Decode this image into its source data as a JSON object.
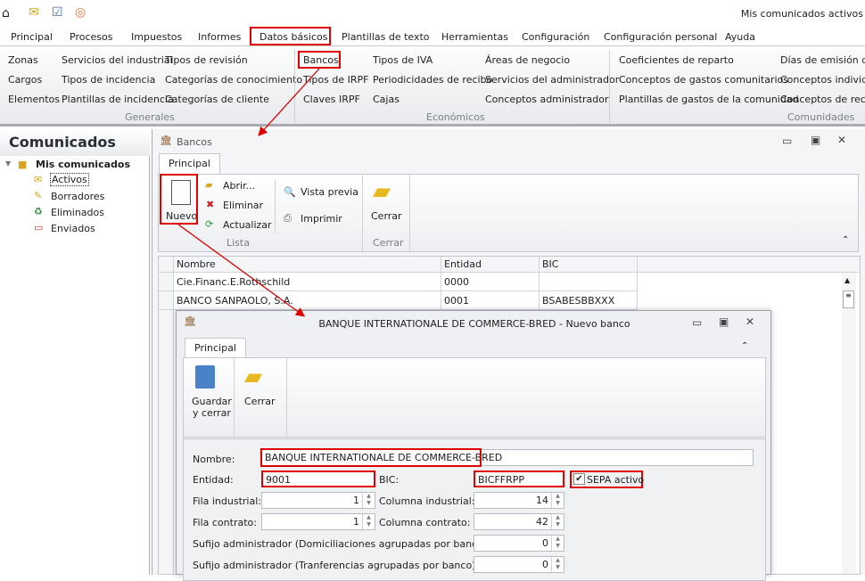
{
  "app": {
    "title": "Mis comunicados activos"
  },
  "colors": {
    "highlight": "#e00000",
    "accent": "#1e1e1e"
  },
  "menu": [
    "Principal",
    "Procesos",
    "Impuestos",
    "Informes",
    "Datos básicos",
    "Plantillas de texto",
    "Herramientas",
    "Configuración",
    "Configuración personal",
    "Ayuda"
  ],
  "ribbon": {
    "generales": {
      "label": "Generales",
      "col1": [
        "Zonas",
        "Cargos",
        "Elementos"
      ],
      "col2": [
        "Servicios del industrial",
        "Tipos de incidencia",
        "Plantillas de incidencia"
      ],
      "col3": [
        "Tipos de revisión",
        "Categorías de conocimiento",
        "Categorías de cliente"
      ]
    },
    "economicos": {
      "label": "Económicos",
      "col1": [
        "Bancos",
        "Tipos de IRPF",
        "Claves IRPF"
      ],
      "col2": [
        "Tipos de IVA",
        "Periodicidades de recibo",
        "Cajas"
      ],
      "col3": [
        "Áreas de negocio",
        "Servicios del administrador",
        "Conceptos administrador"
      ]
    },
    "comunidades": {
      "label": "Comunidades",
      "col1": [
        "Coeficientes de reparto",
        "Conceptos de gastos comunitarios",
        "Plantillas de gastos de la comunidad"
      ],
      "col2": [
        "Días de emisión de r",
        "Conceptos individua",
        "Conceptos de recibo"
      ]
    }
  },
  "left": {
    "title": "Comunicados",
    "root": "Mis comunicados",
    "items": [
      "Activos",
      "Borradores",
      "Eliminados",
      "Enviados"
    ]
  },
  "bancos": {
    "title": "Bancos",
    "tab": "Principal",
    "buttons": {
      "nuevo": "Nuevo",
      "abrir": "Abrir...",
      "eliminar": "Eliminar",
      "actualizar": "Actualizar",
      "vista": "Vista previa",
      "imprimir": "Imprimir",
      "cerrar": "Cerrar"
    },
    "groups": {
      "lista": "Lista",
      "cerrar": "Cerrar"
    },
    "columns": [
      "Nombre",
      "Entidad",
      "BIC"
    ],
    "rows": [
      {
        "nombre": "Cie.Financ.E.Rothschild",
        "entidad": "0000",
        "bic": ""
      },
      {
        "nombre": "BANCO SANPAOLO, S.A.",
        "entidad": "0001",
        "bic": "BSABESBBXXX"
      }
    ]
  },
  "dialog": {
    "title": "BANQUE INTERNATIONALE DE COMMERCE-BRED - Nuevo banco",
    "tab": "Principal",
    "buttons": {
      "guardar1": "Guardar",
      "guardar2": "y cerrar",
      "cerrar": "Cerrar"
    },
    "form": {
      "nombre_label": "Nombre:",
      "nombre": "BANQUE INTERNATIONALE DE COMMERCE-BRED",
      "entidad_label": "Entidad:",
      "entidad": "9001",
      "bic_label": "BIC:",
      "bic": "BICFFRPP",
      "sepa_label": "SEPA activo",
      "sepa_checked": true,
      "fila_ind_label": "Fila industrial:",
      "fila_ind": "1",
      "col_ind_label": "Columna industrial:",
      "col_ind": "14",
      "fila_con_label": "Fila contrato:",
      "fila_con": "1",
      "col_con_label": "Columna contrato:",
      "col_con": "42",
      "suf_dom_label": "Sufijo administrador (Domiciliaciones agrupadas por banco):",
      "suf_dom": "0",
      "suf_tra_label": "Sufijo administrador (Tranferencias agrupadas por banco):",
      "suf_tra": "0"
    }
  }
}
